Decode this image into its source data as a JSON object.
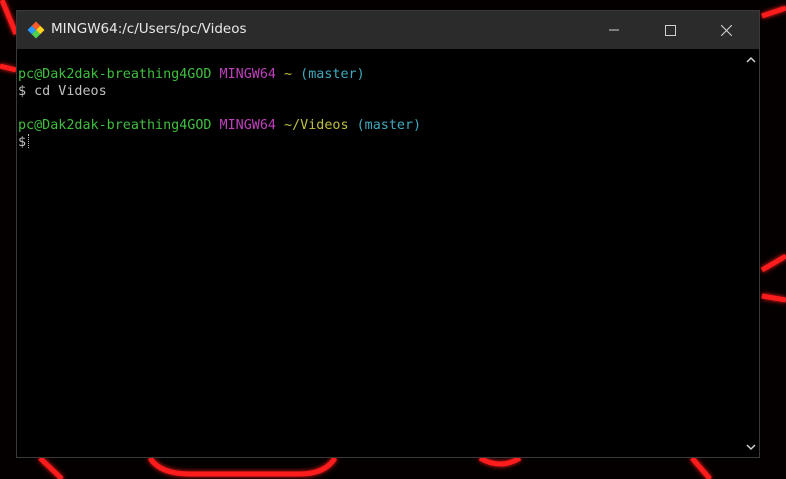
{
  "window": {
    "title": "MINGW64:/c/Users/pc/Videos",
    "icon": "git-bash-icon"
  },
  "controls": {
    "minimize": "minimize-icon",
    "maximize": "maximize-icon",
    "close": "close-icon"
  },
  "terminal": {
    "prompt1": {
      "user_host": "pc@Dak2dak-breathing4GOD",
      "system": "MINGW64",
      "path": "~",
      "branch": "(master)"
    },
    "command1": {
      "symbol": "$",
      "text": "cd Videos"
    },
    "prompt2": {
      "user_host": "pc@Dak2dak-breathing4GOD",
      "system": "MINGW64",
      "path": "~/Videos",
      "branch": "(master)"
    },
    "command2": {
      "symbol": "$",
      "text": ""
    }
  },
  "colors": {
    "user_host": "#3fbf3f",
    "system": "#bf3fbf",
    "path": "#bfbf3f",
    "branch": "#3fa9bf",
    "titlebar": "#2b2b2b",
    "wallpaper_accent": "#ff1a1a"
  }
}
